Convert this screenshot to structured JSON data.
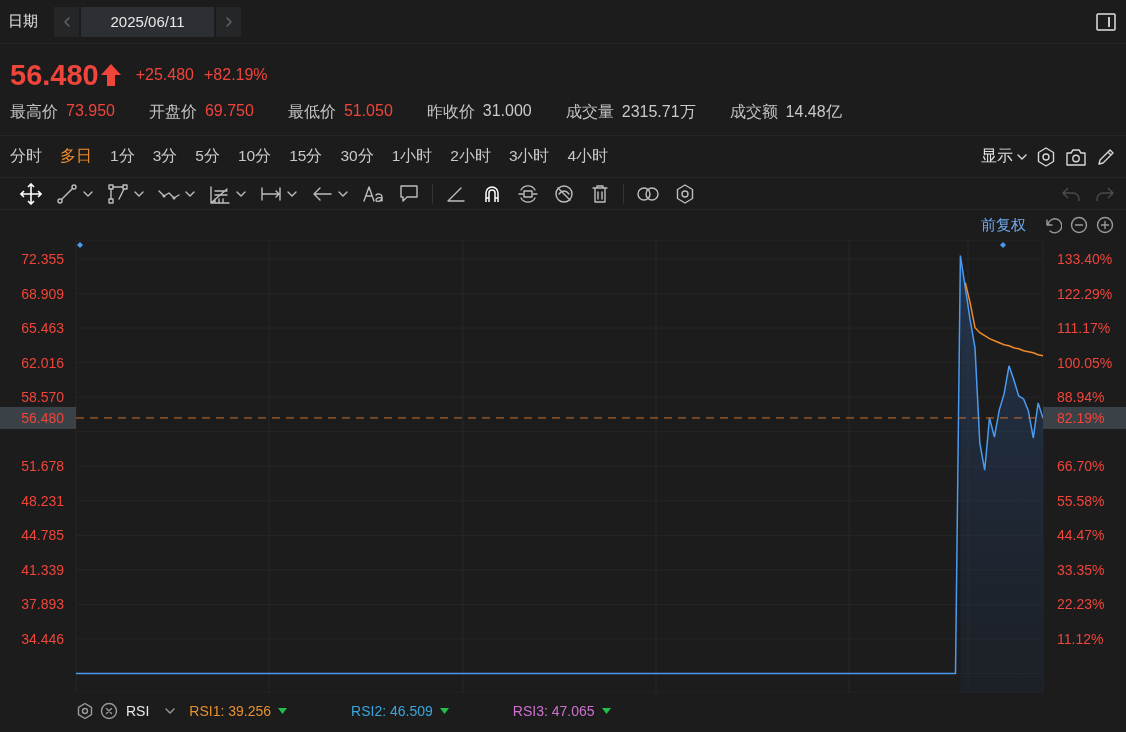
{
  "header": {
    "label": "日期",
    "date": "2025/06/11"
  },
  "quote": {
    "price": "56.480",
    "color": "#f0453a",
    "change": "+25.480",
    "change_pct": "+82.19%"
  },
  "stats": [
    {
      "label": "最高价",
      "value": "73.950",
      "color": "#f0453a"
    },
    {
      "label": "开盘价",
      "value": "69.750",
      "color": "#f0453a"
    },
    {
      "label": "最低价",
      "value": "51.050",
      "color": "#f0453a"
    },
    {
      "label": "昨收价",
      "value": "31.000",
      "color": "#c9c9c9"
    },
    {
      "label": "成交量",
      "value": "2315.71万",
      "color": "#c9c9c9"
    },
    {
      "label": "成交额",
      "value": "14.48亿",
      "color": "#c9c9c9"
    }
  ],
  "periods": [
    {
      "label": "分时",
      "selected": false
    },
    {
      "label": "多日",
      "selected": true
    },
    {
      "label": "1分",
      "selected": false
    },
    {
      "label": "3分",
      "selected": false
    },
    {
      "label": "5分",
      "selected": false
    },
    {
      "label": "10分",
      "selected": false
    },
    {
      "label": "15分",
      "selected": false
    },
    {
      "label": "30分",
      "selected": false
    },
    {
      "label": "1小时",
      "selected": false
    },
    {
      "label": "2小时",
      "selected": false
    },
    {
      "label": "3小时",
      "selected": false
    },
    {
      "label": "4小时",
      "selected": false
    }
  ],
  "display_menu": {
    "label": "显示"
  },
  "history": [
    {
      "kind": "undo",
      "disabled": true
    },
    {
      "kind": "redo",
      "disabled": true
    }
  ],
  "chart": {
    "adjustment": "前复权",
    "right_axis": [
      "133.40%",
      "122.29%",
      "111.17%",
      "100.05%",
      "88.94%",
      "66.70%",
      "55.58%",
      "44.47%",
      "33.35%",
      "22.23%",
      "11.12%"
    ],
    "current_price": "56.480",
    "current_pct": "82.19%",
    "chart_data": {
      "type": "line",
      "categories": [
        null,
        null,
        null,
        null,
        null,
        null,
        null,
        null,
        null,
        null,
        null,
        null,
        null,
        null,
        null,
        null,
        null,
        null,
        null,
        null,
        null,
        null,
        null,
        null,
        null,
        null,
        null,
        null,
        null,
        null,
        null,
        null,
        null,
        null,
        null,
        null,
        null,
        null,
        null,
        null,
        null,
        null,
        null,
        null,
        null,
        null,
        null,
        null,
        null,
        null,
        null,
        null,
        null,
        null,
        null,
        null,
        null,
        null,
        null,
        null,
        null,
        null,
        null,
        null,
        null,
        null,
        null,
        null,
        null,
        null,
        null,
        null,
        null,
        null,
        null,
        null,
        null,
        null,
        null,
        null,
        null,
        null,
        null,
        null,
        null,
        null,
        null,
        null,
        null,
        null,
        null,
        null,
        null,
        null,
        null,
        null,
        null,
        null,
        null,
        null,
        null,
        null,
        null,
        null,
        null,
        null,
        null,
        null,
        null,
        null,
        null,
        null,
        null,
        null,
        null,
        null,
        null,
        null,
        null,
        null,
        null,
        null,
        null,
        null,
        null,
        null,
        null,
        null,
        null,
        null,
        null,
        null,
        null,
        null,
        null,
        null,
        null,
        null,
        null,
        null,
        null,
        null,
        null,
        null,
        null,
        null,
        null,
        null,
        null,
        null,
        null,
        null,
        null,
        null,
        null,
        null,
        null,
        null,
        null,
        null,
        null,
        null,
        null,
        null,
        null,
        null,
        null,
        null,
        null,
        null,
        null,
        null,
        null,
        null,
        null,
        null,
        null,
        null,
        null,
        null,
        null,
        null,
        null,
        null,
        null,
        null,
        null,
        null,
        null,
        null,
        null,
        null,
        null,
        null,
        null,
        null,
        null,
        null,
        null,
        null
      ],
      "series": [
        {
          "color": "#4a9bf0",
          "values": [
            31,
            31,
            31,
            31,
            31,
            31,
            31,
            31,
            31,
            31,
            31,
            31,
            31,
            31,
            31,
            31,
            31,
            31,
            31,
            31,
            31,
            31,
            31,
            31,
            31,
            31,
            31,
            31,
            31,
            31,
            31,
            31,
            31,
            31,
            31,
            31,
            31,
            31,
            31,
            31,
            31,
            31,
            31,
            31,
            31,
            31,
            31,
            31,
            31,
            31,
            31,
            31,
            31,
            31,
            31,
            31,
            31,
            31,
            31,
            31,
            31,
            31,
            31,
            31,
            31,
            31,
            31,
            31,
            31,
            31,
            31,
            31,
            31,
            31,
            31,
            31,
            31,
            31,
            31,
            31,
            31,
            31,
            31,
            31,
            31,
            31,
            31,
            31,
            31,
            31,
            31,
            31,
            31,
            31,
            31,
            31,
            31,
            31,
            31,
            31,
            31,
            31,
            31,
            31,
            31,
            31,
            31,
            31,
            31,
            31,
            31,
            31,
            31,
            31,
            31,
            31,
            31,
            31,
            31,
            31,
            31,
            31,
            31,
            31,
            31,
            31,
            31,
            31,
            31,
            31,
            31,
            31,
            31,
            31,
            31,
            31,
            31,
            31,
            31,
            31,
            31,
            31,
            31,
            31,
            31,
            31,
            31,
            31,
            31,
            31,
            31,
            31,
            31,
            31,
            31,
            31,
            31,
            31,
            31,
            31,
            31,
            31,
            31,
            31,
            31,
            31,
            31,
            31,
            31,
            31,
            31,
            31,
            31,
            31,
            31,
            31,
            31,
            31,
            31,
            31,
            31,
            31,
            72.7,
            69.5,
            66.3,
            63.5,
            54.0,
            51.3,
            56.5,
            54.6,
            57.3,
            58.9,
            61.7,
            60.3,
            58.7,
            58.4,
            57.2,
            54.5,
            58.0,
            56.5
          ]
        },
        {
          "color": "#f08a2b",
          "values": [
            null,
            null,
            null,
            null,
            null,
            null,
            null,
            null,
            null,
            null,
            null,
            null,
            null,
            null,
            null,
            null,
            null,
            null,
            null,
            null,
            null,
            null,
            null,
            null,
            null,
            null,
            null,
            null,
            null,
            null,
            null,
            null,
            null,
            null,
            null,
            null,
            null,
            null,
            null,
            null,
            null,
            null,
            null,
            null,
            null,
            null,
            null,
            null,
            null,
            null,
            null,
            null,
            null,
            null,
            null,
            null,
            null,
            null,
            null,
            null,
            null,
            null,
            null,
            null,
            null,
            null,
            null,
            null,
            null,
            null,
            null,
            null,
            null,
            null,
            null,
            null,
            null,
            null,
            null,
            null,
            null,
            null,
            null,
            null,
            null,
            null,
            null,
            null,
            null,
            null,
            null,
            null,
            null,
            null,
            null,
            null,
            null,
            null,
            null,
            null,
            null,
            null,
            null,
            null,
            null,
            null,
            null,
            null,
            null,
            null,
            null,
            null,
            null,
            null,
            null,
            null,
            null,
            null,
            null,
            null,
            null,
            null,
            null,
            null,
            null,
            null,
            null,
            null,
            null,
            null,
            null,
            null,
            null,
            null,
            null,
            null,
            null,
            null,
            null,
            null,
            null,
            null,
            null,
            null,
            null,
            null,
            null,
            null,
            null,
            null,
            null,
            null,
            null,
            null,
            null,
            null,
            null,
            null,
            null,
            null,
            null,
            null,
            null,
            null,
            null,
            null,
            null,
            null,
            null,
            null,
            null,
            null,
            null,
            null,
            null,
            null,
            null,
            null,
            null,
            null,
            null,
            null,
            null,
            70.0,
            68.0,
            65.5,
            65.0,
            64.7,
            64.4,
            64.2,
            64.0,
            63.8,
            63.7,
            63.5,
            63.4,
            63.2,
            63.1,
            63.0,
            62.8,
            62.7
          ]
        }
      ],
      "ylim": [
        29.06,
        74.25
      ],
      "grid": true,
      "yticks": [
        {
          "value": 72.355,
          "label": "72.355"
        },
        {
          "value": 68.909,
          "label": "68.909"
        },
        {
          "value": 65.463,
          "label": "65.463"
        },
        {
          "value": 62.016,
          "label": "62.016"
        },
        {
          "value": 58.57,
          "label": "58.570"
        },
        {
          "value": 51.678,
          "label": "51.678"
        },
        {
          "value": 48.231,
          "label": "48.231"
        },
        {
          "value": 44.785,
          "label": "44.785"
        },
        {
          "value": 41.339,
          "label": "41.339"
        },
        {
          "value": 37.893,
          "label": "37.893"
        },
        {
          "value": 34.446,
          "label": "34.446"
        }
      ]
    }
  },
  "indicator": {
    "name": "RSI",
    "values": [
      {
        "label": "RSI1: 39.256",
        "color": "#e8912d"
      },
      {
        "label": "RSI2: 46.509",
        "color": "#3aa6dd"
      },
      {
        "label": "RSI3: 47.065",
        "color": "#d070d0"
      }
    ]
  }
}
